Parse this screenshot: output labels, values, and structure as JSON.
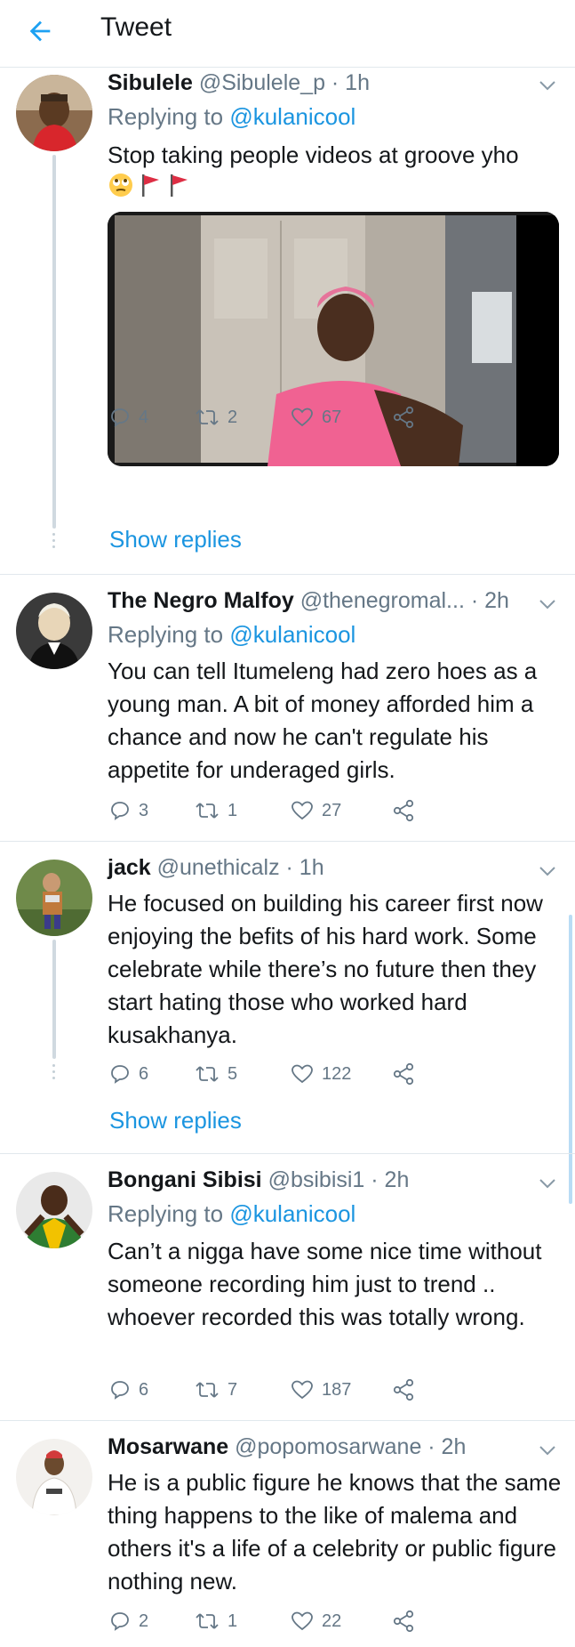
{
  "header": {
    "title": "Tweet"
  },
  "tweets": [
    {
      "name": "Sibulele",
      "handle": "@Sibulele_p · 1h",
      "replying_prefix": "Replying to ",
      "replying_to": "@kulanicool",
      "text": "Stop taking people videos at groove yho",
      "emoji": [
        "🙄",
        "🚩",
        "🚩"
      ],
      "replies": "4",
      "retweets": "2",
      "likes": "67",
      "show_replies": "Show replies"
    },
    {
      "name": "The Negro Malfoy",
      "handle": "@thenegromal... · 2h",
      "replying_prefix": "Replying to ",
      "replying_to": "@kulanicool",
      "text": "You can tell Itumeleng had zero hoes as a young man. A bit of money afforded him a chance and now he can't regulate his appetite for underaged girls.",
      "replies": "3",
      "retweets": "1",
      "likes": "27"
    },
    {
      "name": "jack",
      "handle": "@unethicalz · 1h",
      "text": "He focused on building his career first now enjoying the befits of his hard work. Some celebrate while there’s no future then they start hating those who worked hard kusakhanya.",
      "replies": "6",
      "retweets": "5",
      "likes": "122",
      "show_replies": "Show replies"
    },
    {
      "name": "Bongani Sibisi",
      "handle": "@bsibisi1 · 2h",
      "replying_prefix": "Replying to ",
      "replying_to": "@kulanicool",
      "text": "Can’t a nigga have some nice time without someone recording him just to trend .. whoever recorded this was totally wrong.",
      "replies": "6",
      "retweets": "7",
      "likes": "187"
    },
    {
      "name": "Mosarwane",
      "handle": "@popomosarwane · 2h",
      "text": "He is a public figure he knows that the same thing happens to the like of malema and others it's a life of a celebrity or public figure nothing new.",
      "replies": "2",
      "retweets": "1",
      "likes": "22"
    }
  ],
  "colors": {
    "accent": "#1b95e0",
    "secondary": "#657786",
    "text": "#14171a",
    "divider": "#e1e8ed"
  }
}
